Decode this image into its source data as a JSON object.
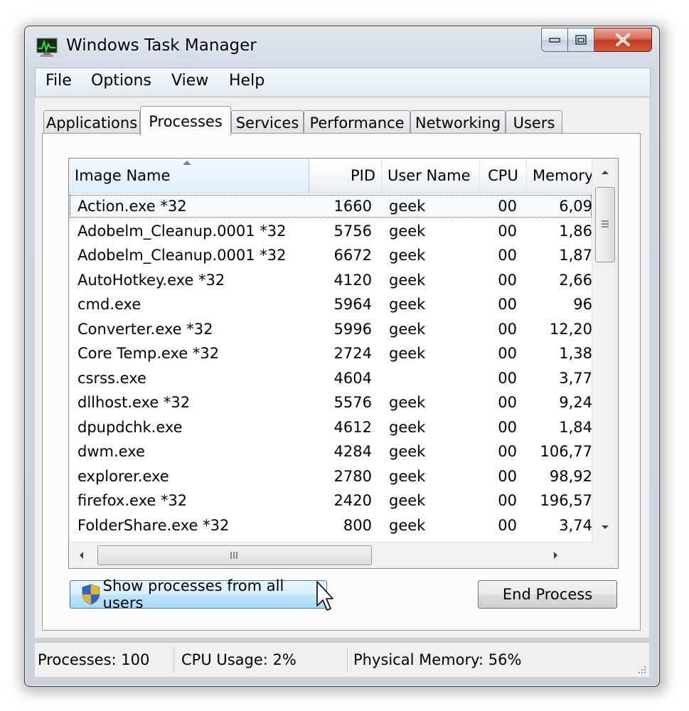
{
  "window": {
    "title": "Windows Task Manager"
  },
  "caption_buttons": {
    "minimize": "minimize-icon",
    "maximize": "maximize-icon",
    "close": "close-icon"
  },
  "menu": [
    "File",
    "Options",
    "View",
    "Help"
  ],
  "tabs": [
    "Applications",
    "Processes",
    "Services",
    "Performance",
    "Networking",
    "Users"
  ],
  "active_tab": "Processes",
  "columns": [
    "Image Name",
    "PID",
    "User Name",
    "CPU",
    "Memory"
  ],
  "sorted_column": "Image Name",
  "processes": [
    {
      "name": "Action.exe *32",
      "pid": "1660",
      "user": "geek",
      "cpu": "00",
      "mem": "6,09"
    },
    {
      "name": "Adobelm_Cleanup.0001 *32",
      "pid": "5756",
      "user": "geek",
      "cpu": "00",
      "mem": "1,86"
    },
    {
      "name": "Adobelm_Cleanup.0001 *32",
      "pid": "6672",
      "user": "geek",
      "cpu": "00",
      "mem": "1,87"
    },
    {
      "name": "AutoHotkey.exe *32",
      "pid": "4120",
      "user": "geek",
      "cpu": "00",
      "mem": "2,66"
    },
    {
      "name": "cmd.exe",
      "pid": "5964",
      "user": "geek",
      "cpu": "00",
      "mem": "96"
    },
    {
      "name": "Converter.exe *32",
      "pid": "5996",
      "user": "geek",
      "cpu": "00",
      "mem": "12,20"
    },
    {
      "name": "Core Temp.exe *32",
      "pid": "2724",
      "user": "geek",
      "cpu": "00",
      "mem": "1,38"
    },
    {
      "name": "csrss.exe",
      "pid": "4604",
      "user": "",
      "cpu": "00",
      "mem": "3,77"
    },
    {
      "name": "dllhost.exe *32",
      "pid": "5576",
      "user": "geek",
      "cpu": "00",
      "mem": "9,24"
    },
    {
      "name": "dpupdchk.exe",
      "pid": "4612",
      "user": "geek",
      "cpu": "00",
      "mem": "1,84"
    },
    {
      "name": "dwm.exe",
      "pid": "4284",
      "user": "geek",
      "cpu": "00",
      "mem": "106,77"
    },
    {
      "name": "explorer.exe",
      "pid": "2780",
      "user": "geek",
      "cpu": "00",
      "mem": "98,92"
    },
    {
      "name": "firefox.exe *32",
      "pid": "2420",
      "user": "geek",
      "cpu": "00",
      "mem": "196,57"
    },
    {
      "name": "FolderShare.exe *32",
      "pid": "800",
      "user": "geek",
      "cpu": "00",
      "mem": "3,74"
    }
  ],
  "selected_process": "Action.exe *32",
  "buttons": {
    "show_all": "Show processes from all users",
    "show_all_icon": "uac-shield-icon",
    "end_process": "End Process"
  },
  "status": {
    "processes": "Processes: 100",
    "cpu": "CPU Usage: 2%",
    "memory": "Physical Memory: 56%"
  }
}
